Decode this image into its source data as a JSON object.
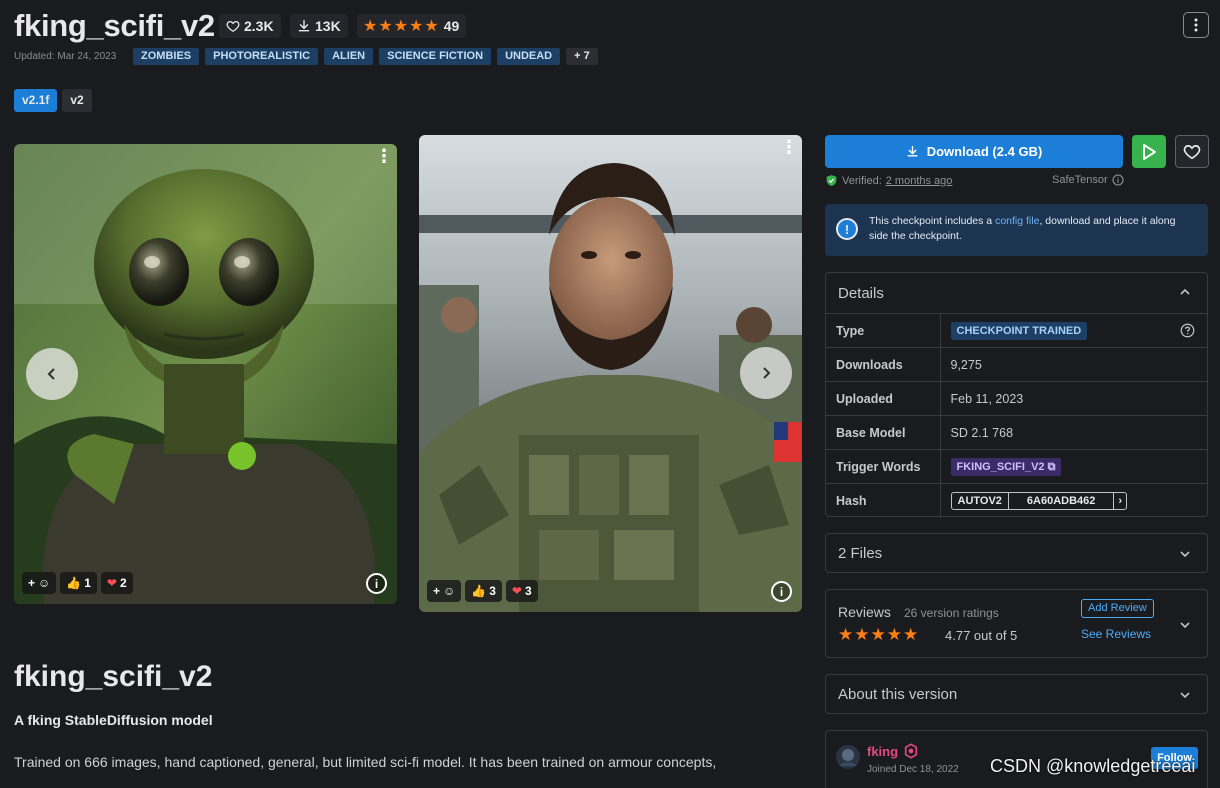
{
  "model": {
    "title": "fking_scifi_v2",
    "stats": {
      "likes": "2.3K",
      "downloads": "13K",
      "rating_count": "49"
    },
    "updated": "Updated: Mar 24, 2023",
    "tags": [
      "ZOMBIES",
      "PHOTOREALISTIC",
      "ALIEN",
      "SCIENCE FICTION",
      "UNDEAD"
    ],
    "more_tags": "+ 7",
    "versions": [
      "v2.1f",
      "v2"
    ]
  },
  "gallery": [
    {
      "reactions": {
        "like": "1",
        "heart": "2"
      }
    },
    {
      "reactions": {
        "like": "3",
        "heart": "3"
      }
    }
  ],
  "content": {
    "heading": "fking_scifi_v2",
    "subheading": "A fking StableDiffusion model",
    "description": "Trained on 666 images, hand captioned, general, but limited sci-fi model. It has been trained on armour concepts,"
  },
  "sidebar": {
    "download_label": "Download (2.4 GB)",
    "verified_label": "Verified:",
    "verified_time": "2 months ago",
    "safetensor_label": "SafeTensor",
    "alert": {
      "pre": "This checkpoint includes a ",
      "link": "config file",
      "post": ", download and place it along side the checkpoint."
    },
    "details": {
      "title": "Details",
      "rows": [
        {
          "key": "Type",
          "value": "CHECKPOINT TRAINED"
        },
        {
          "key": "Downloads",
          "value": "9,275"
        },
        {
          "key": "Uploaded",
          "value": "Feb 11, 2023"
        },
        {
          "key": "Base Model",
          "value": "SD 2.1 768"
        },
        {
          "key": "Trigger Words",
          "value": "FKING_SCIFI_V2"
        },
        {
          "key": "Hash",
          "value": "6A60ADB462",
          "hash_type": "AUTOV2"
        }
      ]
    },
    "files_label": "2 Files",
    "reviews": {
      "title": "Reviews",
      "count_label": "26 version ratings",
      "score_label": "4.77 out of 5",
      "add_label": "Add Review",
      "see_label": "See Reviews"
    },
    "about_label": "About this version",
    "creator": {
      "name": "fking",
      "joined": "Joined Dec 18, 2022",
      "follow_label": "Follow"
    }
  },
  "watermark": "CSDN @knowledgetreeai",
  "colors": {
    "accent": "#1c7ed6",
    "star": "#fd7e14",
    "success": "#37b24d",
    "background": "#1a1b1e"
  }
}
